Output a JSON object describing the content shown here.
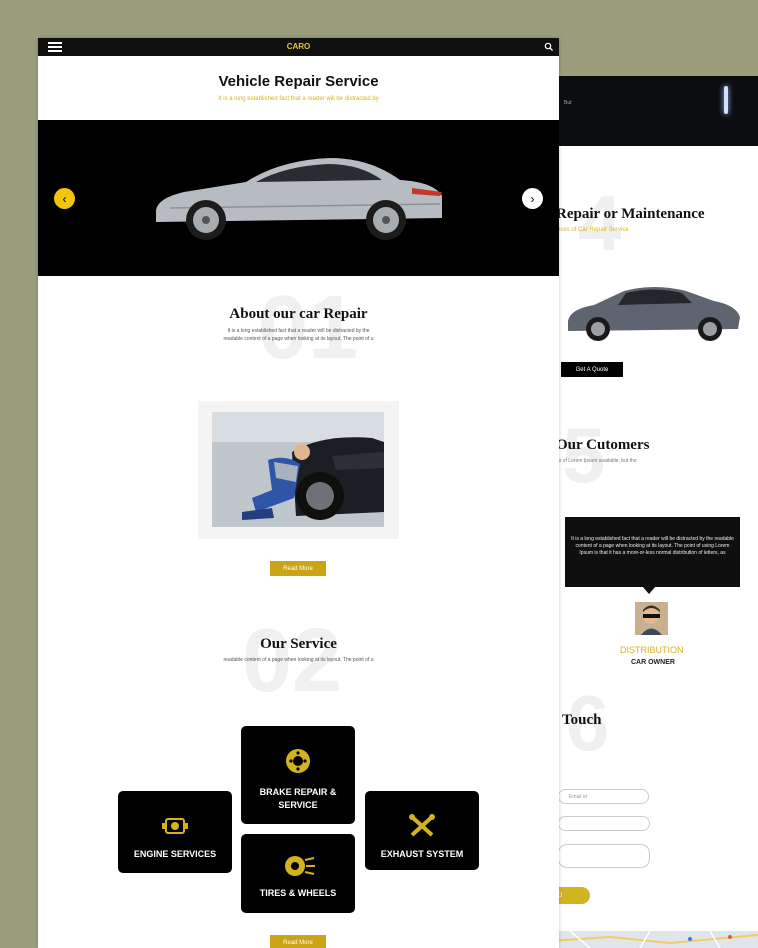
{
  "front": {
    "brand": "CARO",
    "title": "Vehicle Repair Service",
    "subtitle": "It is a long established fact that a reader will be distracted by",
    "about": {
      "number": "01",
      "heading": "About our car Repair",
      "text1": "It is a long established fact that a reader will be distracted by the",
      "text2": "readable content of a page when looking at its layout. The point of u",
      "read_more": "Read More"
    },
    "service": {
      "number": "02",
      "heading": "Our Service",
      "text": "readable content of a page when looking at its layout. The point of u",
      "cards": [
        {
          "label": "BRAKE REPAIR & SERVICE",
          "icon": "brake-disc-icon"
        },
        {
          "label": "ENGINE SERVICES",
          "icon": "engine-icon"
        },
        {
          "label": "EXHAUST SYSTEM",
          "icon": "exhaust-tools-icon"
        },
        {
          "label": "TIRES & WHEELS",
          "icon": "wheel-icon"
        }
      ],
      "read_more": "Read More"
    }
  },
  "back": {
    "hero_text": "But",
    "repair": {
      "number": "4",
      "heading": "Repair or Maintenance",
      "sub": "vices of Car Repair Service",
      "button": "Get A Quote"
    },
    "customers": {
      "number": "5",
      "heading": "Our Cutomers",
      "sub": "es of Lorem Ipsum available, but the",
      "testimonial": "It is a long established fact that a reader will be distracted by the readable content of a page when looking at its layout. The point of using Lorem Ipsum is that it has a more-or-less normal distribution of letters, as",
      "name": "DISTRIBUTION",
      "role": "CAR OWNER"
    },
    "contact": {
      "number": "6",
      "heading": "Touch",
      "email_placeholder": "Email id",
      "send": "D"
    }
  },
  "colors": {
    "accent": "#d4b320",
    "dark": "#101010",
    "background": "#9c9d7c"
  }
}
